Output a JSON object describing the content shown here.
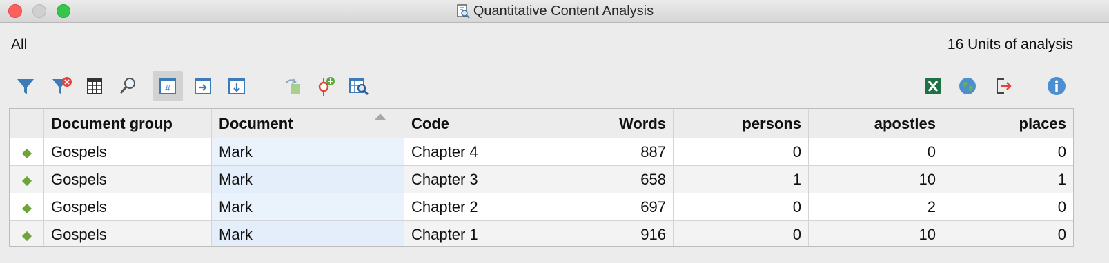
{
  "window": {
    "title": "Quantitative Content Analysis"
  },
  "header": {
    "filter_label": "All",
    "units_label": "16 Units of analysis"
  },
  "toolbar": {
    "icons": [
      "filter-icon",
      "clear-filter-icon",
      "table-columns-icon",
      "search-icon",
      "numbers-view-icon",
      "export-right-icon",
      "export-down-icon",
      "transfer-icon",
      "add-code-icon",
      "table-search-icon",
      "excel-icon",
      "web-export-icon",
      "export-icon",
      "info-icon"
    ],
    "active": "numbers-view-icon"
  },
  "table": {
    "columns": [
      "",
      "Document group",
      "Document",
      "Code",
      "Words",
      "persons",
      "apostles",
      "places"
    ],
    "sorted_column": "Document",
    "rows": [
      [
        "Gospels",
        "Mark",
        "Chapter 4",
        "887",
        "0",
        "0",
        "0"
      ],
      [
        "Gospels",
        "Mark",
        "Chapter 3",
        "658",
        "1",
        "10",
        "1"
      ],
      [
        "Gospels",
        "Mark",
        "Chapter 2",
        "697",
        "0",
        "2",
        "0"
      ],
      [
        "Gospels",
        "Mark",
        "Chapter 1",
        "916",
        "0",
        "10",
        "0"
      ]
    ]
  },
  "colors": {
    "accent": "#3d7ab8",
    "row_marker": "#6ea538",
    "excel": "#1e7145"
  }
}
